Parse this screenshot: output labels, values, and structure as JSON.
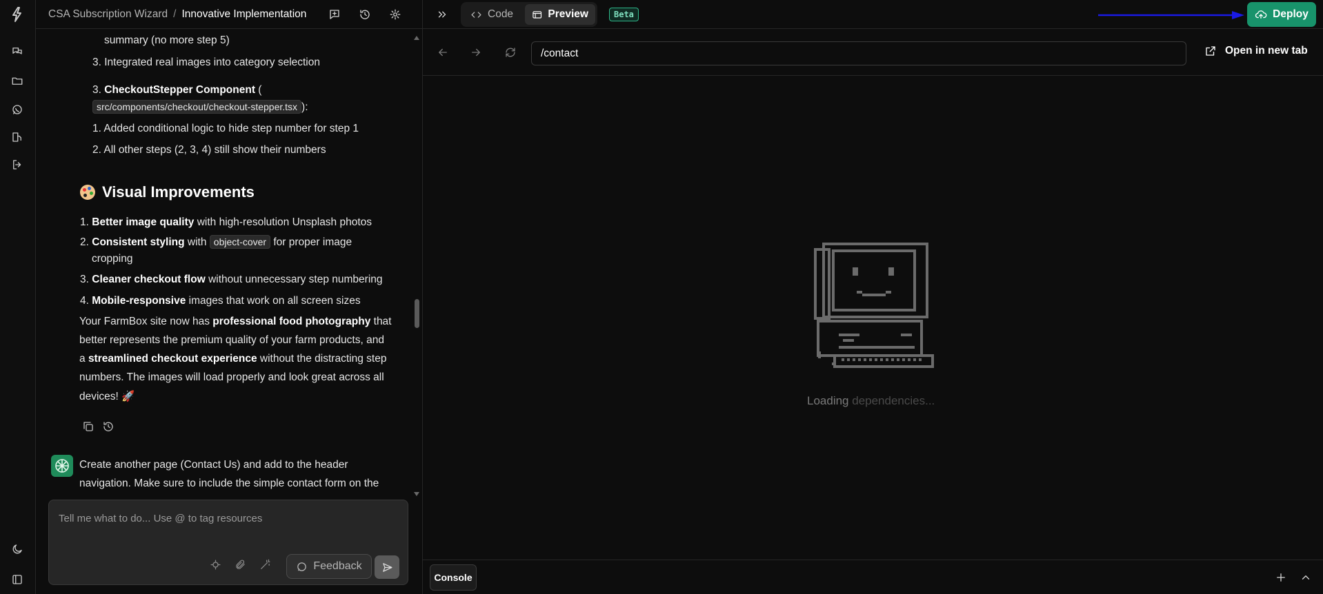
{
  "header": {
    "project": "CSA Subscription Wizard",
    "separator": "/",
    "current": "Innovative Implementation",
    "tabs": [
      {
        "label": "Code",
        "active": false
      },
      {
        "label": "Preview",
        "active": true
      }
    ],
    "beta_label": "Beta",
    "deploy_label": "Deploy",
    "accent_color": "#18936b"
  },
  "chat": {
    "line1": "summary (no more step 5)",
    "item3a": "3. Integrated real images into category selection",
    "checkout_num": "3.",
    "checkout_title": "CheckoutStepper Component",
    "checkout_paren": " (",
    "checkout_path": "src/components/checkout/checkout-stepper.tsx",
    "checkout_close": "):",
    "sub1": "1. Added conditional logic to hide step number for step 1",
    "sub2": "2. All other steps (2, 3, 4) still show their numbers",
    "heading": "Visual Improvements",
    "v1_num": "1.",
    "v1_bold": "Better image quality",
    "v1_rest": " with high-resolution Unsplash photos",
    "v2_num": "2.",
    "v2_bold": "Consistent styling",
    "v2_mid": " with ",
    "v2_code": "object-cover",
    "v2_rest": " for proper image",
    "v2_cont": "cropping",
    "v3_num": "3.",
    "v3_bold": "Cleaner checkout flow",
    "v3_rest": " without unnecessary step numbering",
    "v4_num": "4.",
    "v4_bold": "Mobile-responsive",
    "v4_rest": " images that work on all screen sizes",
    "p1a": "Your FarmBox site now has ",
    "p1b": "professional food photography",
    "p1c": " that",
    "p2": "better represents the premium quality of your farm products, and",
    "p3a": "a ",
    "p3b": "streamlined checkout experience",
    "p3c": " without the distracting step",
    "p4": "numbers. The images will load properly and look great across all",
    "p5": "devices! 🚀",
    "user1": "Create another page (Contact Us) and add to the header",
    "user2": "navigation. Make sure to include the simple contact form on the"
  },
  "composer": {
    "placeholder": "Tell me what to do... Use @ to tag resources",
    "feedback_label": "Feedback"
  },
  "preview": {
    "url": "/contact",
    "open_new_tab": "Open in new tab",
    "loading_a": "Loading",
    "loading_b": " dependencies..."
  },
  "console": {
    "label": "Console"
  }
}
